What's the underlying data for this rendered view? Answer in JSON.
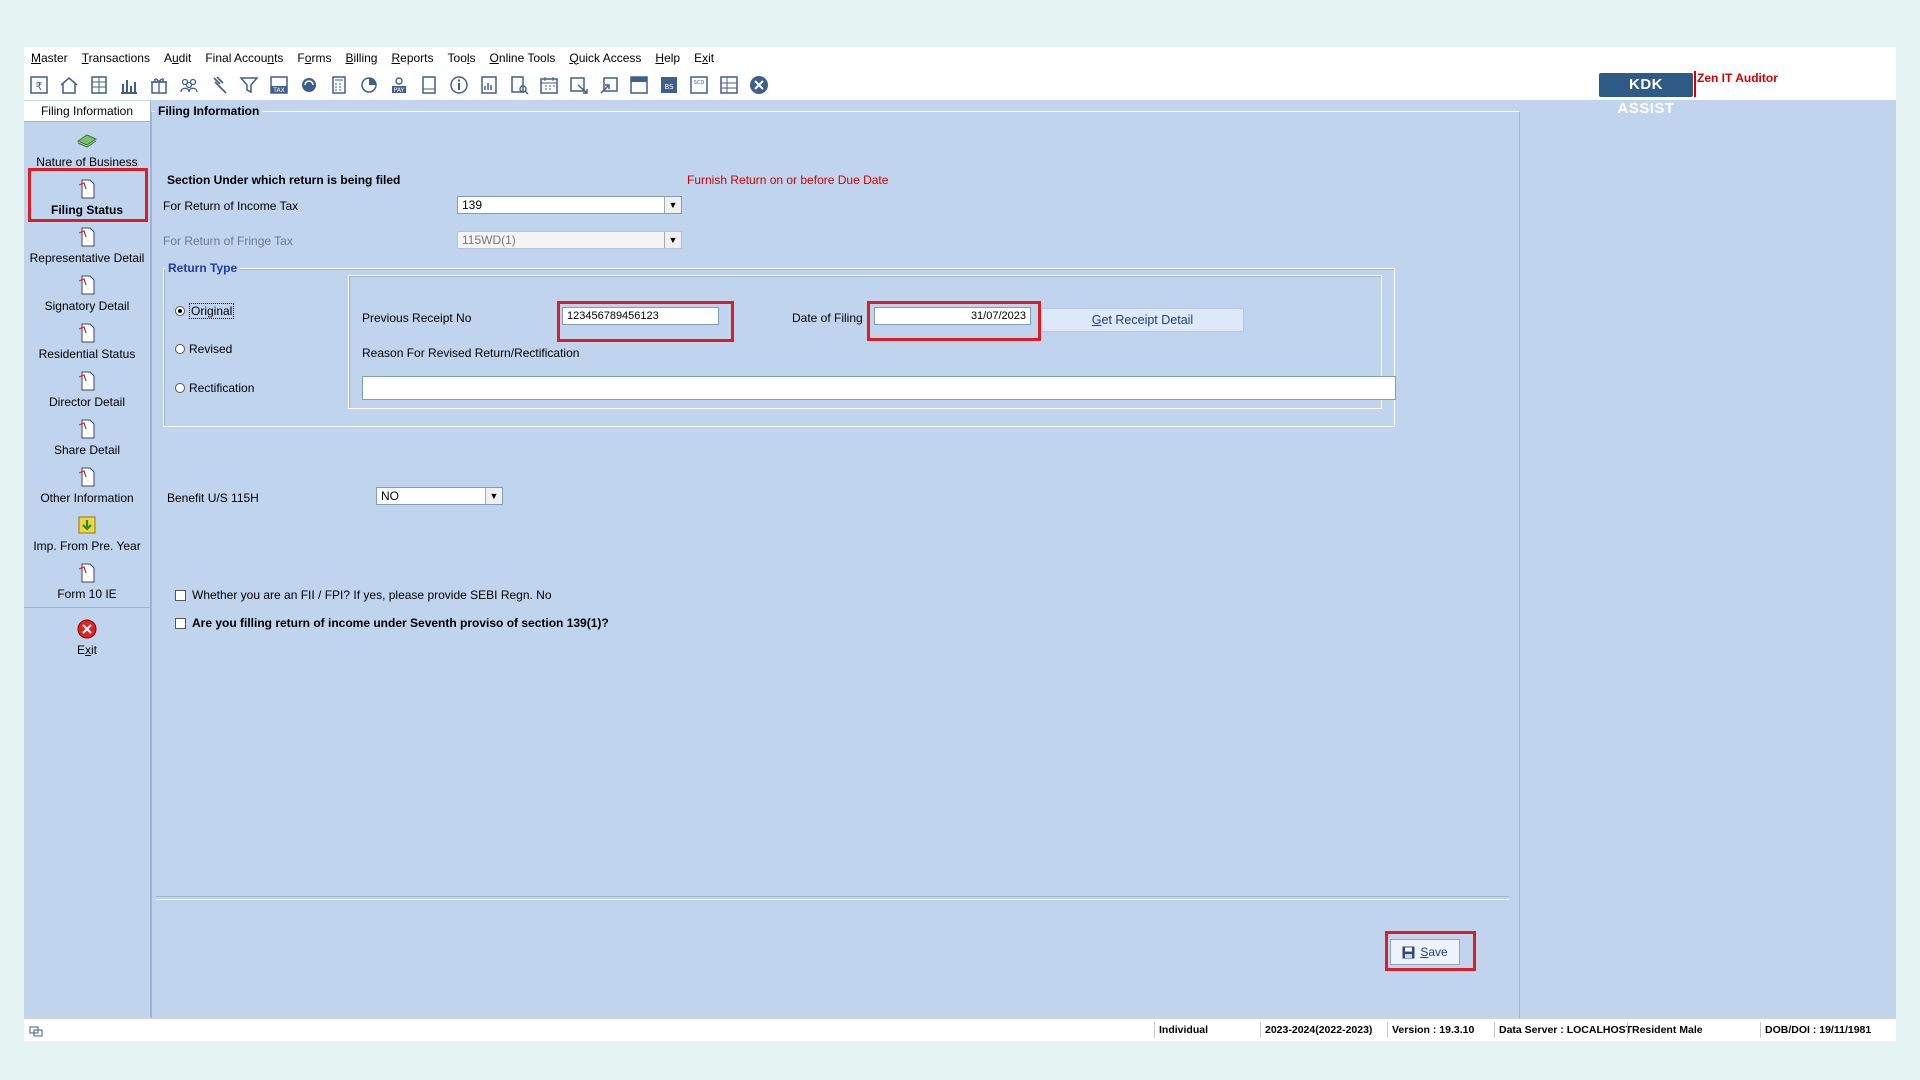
{
  "menu": [
    {
      "pre": "",
      "u": "M",
      "post": "aster"
    },
    {
      "pre": "",
      "u": "T",
      "post": "ransactions"
    },
    {
      "pre": "A",
      "u": "u",
      "post": "dit"
    },
    {
      "pre": "Final Accou",
      "u": "n",
      "post": "ts"
    },
    {
      "pre": "F",
      "u": "o",
      "post": "rms"
    },
    {
      "pre": "",
      "u": "B",
      "post": "illing"
    },
    {
      "pre": "",
      "u": "R",
      "post": "eports"
    },
    {
      "pre": "Too",
      "u": "l",
      "post": "s"
    },
    {
      "pre": "",
      "u": "O",
      "post": "nline Tools"
    },
    {
      "pre": "",
      "u": "Q",
      "post": "uick Access"
    },
    {
      "pre": "",
      "u": "H",
      "post": "elp"
    },
    {
      "pre": "E",
      "u": "x",
      "post": "it"
    }
  ],
  "toolbar": {
    "brand": "KDK ASSIST",
    "product": "Zen IT Auditor",
    "icons": [
      "rupee-book-icon",
      "home-icon",
      "ledger-icon",
      "bar-chart-icon",
      "gift-icon",
      "users-icon",
      "gavel-icon",
      "filter-icon",
      "tax-icon",
      "refresh-icon",
      "calculator-icon",
      "pie-chart-icon",
      "pay-icon",
      "notebook-icon",
      "info-icon",
      "report-icon",
      "document-search-icon",
      "calendar-icon",
      "export-icon",
      "import-icon",
      "form-icon",
      "balance-sheet-icon",
      "scd-icon",
      "grid-icon",
      "close-circle-icon"
    ],
    "tax_text": "TAX",
    "pay_text": "PAY",
    "bs_text": "BS",
    "scd_text": "SCD"
  },
  "leftnav": {
    "title": "Filing Information",
    "items": [
      {
        "label": "Nature of Business",
        "icon": "money-icon"
      },
      {
        "label": "Filing Status",
        "icon": "document-icon",
        "active": true
      },
      {
        "label": "Representative Detail",
        "icon": "document-icon"
      },
      {
        "label": "Signatory Detail",
        "icon": "document-icon"
      },
      {
        "label": "Residential Status",
        "icon": "document-icon"
      },
      {
        "label": "Director Detail",
        "icon": "document-icon"
      },
      {
        "label": "Share Detail",
        "icon": "document-icon"
      },
      {
        "label": "Other Information",
        "icon": "document-icon"
      },
      {
        "label": "Imp. From Pre. Year",
        "icon": "import-arrow-icon"
      },
      {
        "label": "Form 10 IE",
        "icon": "document-icon"
      }
    ],
    "exit": {
      "pre": "E",
      "u": "x",
      "post": "it"
    }
  },
  "main": {
    "legend": "Filing Information",
    "section_heading": "Section Under which return is being filed",
    "due_note": "Furnish Return on or before Due Date",
    "income_tax_label": "For Return of Income Tax",
    "income_tax_value": "139",
    "fringe_tax_label": "For Return of Fringe Tax",
    "fringe_tax_value": "115WD(1)",
    "return_type": {
      "legend": "Return Type",
      "options": [
        "Original",
        "Revised",
        "Rectification"
      ],
      "selected": "Original"
    },
    "previous_receipt_label": "Previous Receipt No",
    "previous_receipt_value": "123456789456123",
    "date_of_filing_label": "Date of Filing",
    "date_of_filing_value": "31/07/2023",
    "get_receipt": {
      "u": "G",
      "post": "et Receipt Detail"
    },
    "reason_label": "Reason For Revised Return/Rectification",
    "reason_value": "",
    "benefit_label": "Benefit U/S 115H",
    "benefit_value": "NO",
    "fii_question": "Whether you are an FII / FPI?  If yes, please provide SEBI Regn. No",
    "seventh_proviso_question": "Are you filling return of income under Seventh proviso of section 139(1)?",
    "save": {
      "u": "S",
      "post": "ave"
    }
  },
  "status": {
    "assessee_type": "Individual",
    "assessment_year": "2023-2024(2022-2023)",
    "version": "Version : 19.3.10",
    "data_server": "Data Server : LOCALHOST",
    "residential": "Resident Male",
    "dob": "DOB/DOI : 19/11/1981"
  },
  "colors": {
    "app_bg": "#c0d4ee",
    "highlight": "#d81f26",
    "brand_bg": "#2e5a86",
    "accent_red": "#d40000",
    "legend_blue": "#1f3fa0"
  }
}
